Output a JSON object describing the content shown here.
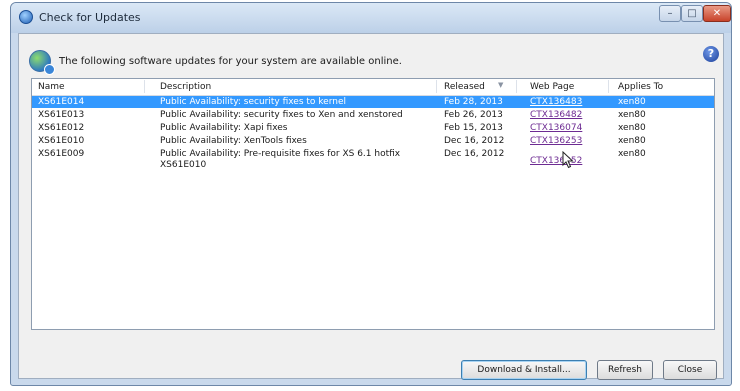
{
  "window": {
    "title": "Check for Updates",
    "controls": {
      "minimize": "–",
      "maximize": "□",
      "close": "✕"
    }
  },
  "header": {
    "intro": "The following software updates for your system are available online.",
    "help": "?"
  },
  "table": {
    "columns": [
      "Name",
      "Description",
      "Released",
      "Web Page",
      "Applies To"
    ],
    "rows": [
      {
        "name": "XS61E014",
        "description": "Public Availability: security fixes to kernel",
        "released": "Feb 28, 2013",
        "web_page": "CTX136483",
        "applies_to": "xen80",
        "selected": true
      },
      {
        "name": "XS61E013",
        "description": "Public Availability: security fixes to Xen and xenstored",
        "released": "Feb 26, 2013",
        "web_page": "CTX136482",
        "applies_to": "xen80",
        "selected": false
      },
      {
        "name": "XS61E012",
        "description": "Public Availability: Xapi fixes",
        "released": "Feb 15, 2013",
        "web_page": "CTX136074",
        "applies_to": "xen80",
        "selected": false
      },
      {
        "name": "XS61E010",
        "description": "Public Availability: XenTools fixes",
        "released": "Dec 16, 2012",
        "web_page": "CTX136253",
        "applies_to": "xen80",
        "selected": false
      },
      {
        "name": "XS61E009",
        "description": "Public Availability: Pre-requisite fixes for XS 6.1 hotfix XS61E010",
        "released": "Dec 16, 2012",
        "web_page": "CTX136252",
        "applies_to": "xen80",
        "selected": false
      }
    ]
  },
  "buttons": {
    "download_install": "Download & Install...",
    "refresh": "Refresh",
    "close": "Close"
  },
  "colors": {
    "selection": "#3399ff",
    "link": "#6d2b92",
    "title_bar": "#c9d9ec"
  }
}
